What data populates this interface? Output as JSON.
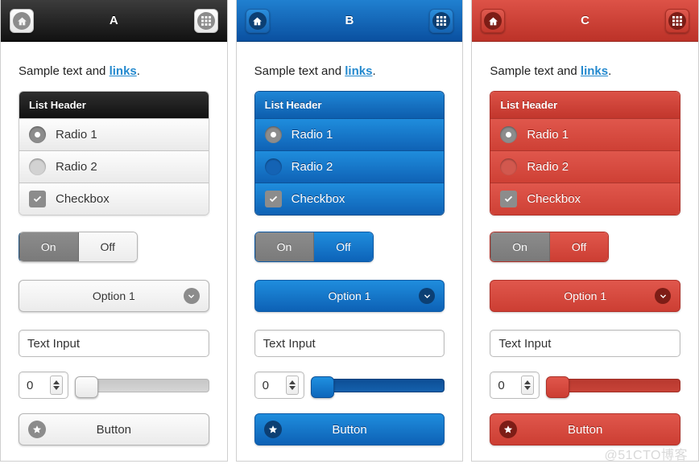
{
  "page": {
    "watermark": "@51CTO博客"
  },
  "icons": {
    "home": "home-icon",
    "grid": "grid-icon",
    "chevron_down": "chevron-down-icon",
    "star": "star-icon",
    "check": "check-icon",
    "spinner_up": "triangle-up-icon",
    "spinner_down": "triangle-down-icon"
  },
  "common": {
    "sample_text_prefix": "Sample text and ",
    "sample_link": "links",
    "sample_text_suffix": ".",
    "list_header": "List Header",
    "radio_1": "Radio 1",
    "radio_2": "Radio 2",
    "checkbox": "Checkbox",
    "toggle_on": "On",
    "toggle_off": "Off",
    "select_value": "Option 1",
    "text_input_value": "Text Input",
    "spinner_value": "0",
    "button_label": "Button"
  },
  "panels": [
    {
      "id": "a",
      "title": "A",
      "accent": "#2a2a2a",
      "header_bg_top": "#3c3c3c",
      "header_bg_bottom": "#111111",
      "link_color": "#2489ce"
    },
    {
      "id": "b",
      "title": "B",
      "accent": "#1f8ddd",
      "header_bg_top": "#2080d0",
      "header_bg_bottom": "#0a50a0",
      "link_color": "#2489ce"
    },
    {
      "id": "c",
      "title": "C",
      "accent": "#dd5247",
      "header_bg_top": "#dd5247",
      "header_bg_bottom": "#bc3228",
      "link_color": "#2489ce"
    }
  ]
}
